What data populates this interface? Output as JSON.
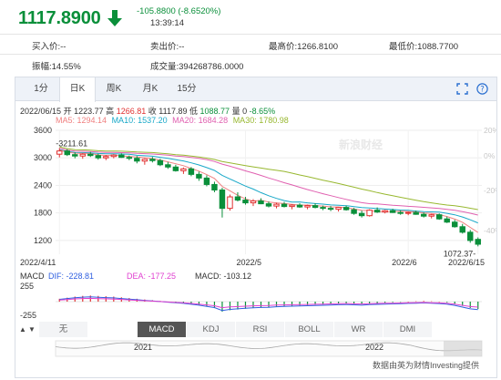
{
  "quote": {
    "price": "1117.8900",
    "change": "-105.8800 (-8.6520%)",
    "time": "13:39:14",
    "direction_icon": "down-arrow-icon",
    "color_down": "#0a8f3a",
    "color_up": "#e03030"
  },
  "info": {
    "buy_price": "买入价:--",
    "sell_price": "卖出价:--",
    "high": "最高价:1266.8100",
    "low": "最低价:1088.7700",
    "amplitude": "振幅:14.55%",
    "volume": "成交量:394268786.0000"
  },
  "tabs": [
    "1分",
    "日K",
    "周K",
    "月K",
    "15分"
  ],
  "active_tab": "日K",
  "toolbar_icons": [
    "fullscreen-icon",
    "help-icon"
  ],
  "ohlc": {
    "date": "2022/06/15",
    "open_label": "开",
    "open": "1223.77",
    "high_label": "高",
    "high": "1266.81",
    "close_label": "收",
    "close": "1117.89",
    "low_label": "低",
    "low": "1088.77",
    "volume_label": "量",
    "volume": "0",
    "pct": "-8.65%"
  },
  "ma": [
    {
      "label": "MA5: 1294.14",
      "color": "#f08080"
    },
    {
      "label": "MA10: 1537.20",
      "color": "#18a8c8"
    },
    {
      "label": "MA20: 1684.28",
      "color": "#e060b0"
    },
    {
      "label": "MA30: 1780.98",
      "color": "#98b830"
    }
  ],
  "price_axis": [
    "3600",
    "3000",
    "2400",
    "1800",
    "1200"
  ],
  "pct_axis": [
    "20%",
    "0%",
    "-20%",
    "-40%"
  ],
  "date_axis": [
    "2022/4/11",
    "2022/5",
    "2022/6",
    "2022/6/15"
  ],
  "annotations": {
    "max": "3211.61",
    "min": "1072.37"
  },
  "macd": {
    "label": "MACD",
    "dif": "DIF: -228.81",
    "dea": "DEA: -177.25",
    "macd": "MACD: -103.12",
    "axis_top": "255",
    "axis_bottom": "-255",
    "dif_color": "#3060e0",
    "dea_color": "#e040d0"
  },
  "indicators": [
    "无",
    "MACD",
    "KDJ",
    "RSI",
    "BOLL",
    "WR",
    "DMI"
  ],
  "active_indicator": "MACD",
  "nav_years": [
    "2021",
    "2022"
  ],
  "source": "数据由英为财情Investing提供",
  "watermark": "新浪财经",
  "chart_data": {
    "type": "candlestick",
    "note_x": "trading days 2022/4/11 – 2022/6/15",
    "ylim": [
      900,
      3600
    ],
    "candles": [
      [
        3080,
        3211,
        3010,
        3150
      ],
      [
        3150,
        3190,
        3040,
        3070
      ],
      [
        3070,
        3120,
        2990,
        3040
      ],
      [
        3040,
        3100,
        2980,
        3080
      ],
      [
        3080,
        3130,
        3020,
        3050
      ],
      [
        3050,
        3090,
        2960,
        3000
      ],
      [
        3000,
        3060,
        2950,
        3030
      ],
      [
        3030,
        3080,
        2990,
        3060
      ],
      [
        3060,
        3100,
        3000,
        3010
      ],
      [
        3010,
        3050,
        2950,
        2990
      ],
      [
        2990,
        3040,
        2880,
        2930
      ],
      [
        2930,
        2990,
        2850,
        2970
      ],
      [
        2970,
        3020,
        2900,
        2940
      ],
      [
        2940,
        2980,
        2820,
        2850
      ],
      [
        2850,
        2910,
        2760,
        2800
      ],
      [
        2800,
        2850,
        2700,
        2720
      ],
      [
        2720,
        2790,
        2650,
        2760
      ],
      [
        2760,
        2800,
        2600,
        2640
      ],
      [
        2640,
        2700,
        2500,
        2560
      ],
      [
        2560,
        2620,
        2380,
        2420
      ],
      [
        2420,
        2480,
        2250,
        2300
      ],
      [
        2300,
        2350,
        1700,
        1900
      ],
      [
        1900,
        2200,
        1850,
        2150
      ],
      [
        2150,
        2250,
        2050,
        2080
      ],
      [
        2080,
        2150,
        1980,
        2020
      ],
      [
        2020,
        2100,
        1950,
        2060
      ],
      [
        2060,
        2120,
        1990,
        2000
      ],
      [
        2000,
        2050,
        1920,
        1950
      ],
      [
        1950,
        2020,
        1900,
        1990
      ],
      [
        1990,
        2040,
        1920,
        1940
      ],
      [
        1940,
        1990,
        1880,
        1970
      ],
      [
        1970,
        2010,
        1910,
        1930
      ],
      [
        1930,
        1980,
        1880,
        1960
      ],
      [
        1960,
        2010,
        1900,
        1920
      ],
      [
        1920,
        1960,
        1860,
        1900
      ],
      [
        1900,
        1950,
        1840,
        1880
      ],
      [
        1880,
        1930,
        1830,
        1920
      ],
      [
        1920,
        1960,
        1850,
        1870
      ],
      [
        1870,
        1910,
        1760,
        1790
      ],
      [
        1790,
        1850,
        1700,
        1740
      ],
      [
        1740,
        1880,
        1720,
        1860
      ],
      [
        1860,
        1920,
        1800,
        1820
      ],
      [
        1820,
        1870,
        1790,
        1850
      ],
      [
        1850,
        1890,
        1800,
        1810
      ],
      [
        1810,
        1850,
        1760,
        1790
      ],
      [
        1790,
        1830,
        1750,
        1810
      ],
      [
        1810,
        1850,
        1760,
        1770
      ],
      [
        1770,
        1810,
        1700,
        1730
      ],
      [
        1730,
        1780,
        1680,
        1760
      ],
      [
        1760,
        1790,
        1650,
        1670
      ],
      [
        1670,
        1720,
        1580,
        1600
      ],
      [
        1600,
        1650,
        1480,
        1500
      ],
      [
        1500,
        1560,
        1350,
        1380
      ],
      [
        1380,
        1430,
        1150,
        1200
      ],
      [
        1224,
        1267,
        1072,
        1118
      ]
    ],
    "macd_hist": [
      40,
      55,
      70,
      80,
      85,
      80,
      75,
      70,
      60,
      50,
      40,
      30,
      20,
      10,
      0,
      -10,
      -20,
      -35,
      -50,
      -70,
      -90,
      -140,
      -120,
      -110,
      -100,
      -90,
      -85,
      -80,
      -70,
      -65,
      -60,
      -55,
      -50,
      -45,
      -40,
      -35,
      -30,
      -25,
      -30,
      -35,
      -25,
      -20,
      -15,
      -10,
      -5,
      0,
      5,
      10,
      5,
      0,
      -10,
      -30,
      -60,
      -90,
      -103
    ]
  }
}
